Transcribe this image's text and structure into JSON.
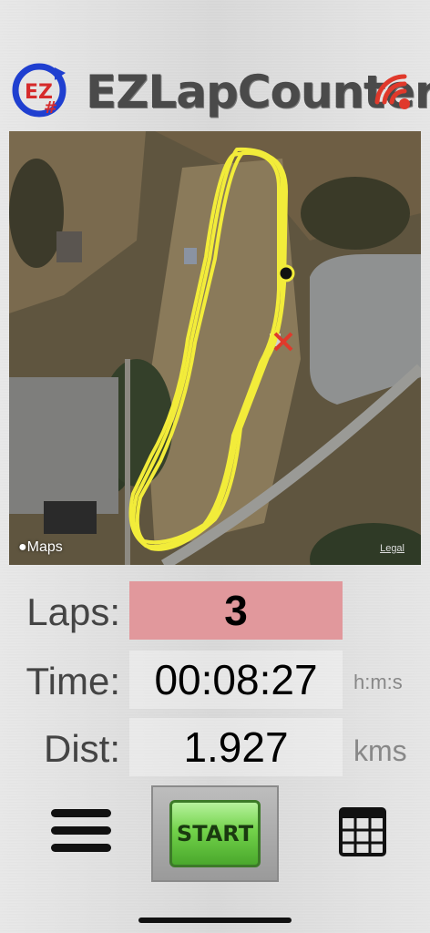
{
  "header": {
    "app_title": "EZLapCounter",
    "logo_text": "EZ",
    "logo_hash": "#"
  },
  "map": {
    "credit": "Maps",
    "legal": "Legal"
  },
  "stats": {
    "laps_label": "Laps:",
    "laps_value": "3",
    "time_label": "Time:",
    "time_value": "00:08:27",
    "time_unit": "h:m:s",
    "dist_label": "Dist:",
    "dist_value": "1.927",
    "dist_unit": "kms"
  },
  "controls": {
    "start_label": "START",
    "menu_icon": "hamburger-menu-icon",
    "grid_icon": "table-grid-icon"
  },
  "colors": {
    "laps_bg": "#e1989c",
    "track": "#f2ec3a",
    "start_green": "#72d24a",
    "signal_red": "#e0392b"
  }
}
